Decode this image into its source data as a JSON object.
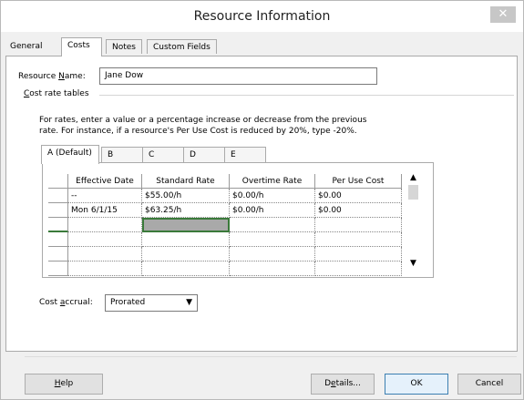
{
  "window": {
    "title": "Resource Information",
    "close_glyph": "✕"
  },
  "tabs": [
    {
      "label": "General"
    },
    {
      "label": "Costs"
    },
    {
      "label": "Notes"
    },
    {
      "label": "Custom Fields"
    }
  ],
  "resource_name": {
    "label_prefix": "Resource ",
    "label_underlined": "N",
    "label_suffix": "ame:",
    "value": "Jane Dow"
  },
  "cost_rate_tables": {
    "group_label_underlined": "C",
    "group_label_suffix": "ost rate tables",
    "instructions_line1": "For rates, enter a value or a percentage increase or decrease from the previous",
    "instructions_line2": "rate. For instance, if a resource's Per Use Cost is reduced by 20%, type -20%.",
    "subtabs": [
      "A (Default)",
      "B",
      "C",
      "D",
      "E"
    ],
    "columns": [
      "Effective Date",
      "Standard Rate",
      "Overtime Rate",
      "Per Use Cost"
    ],
    "rows": [
      [
        "--",
        "$55.00/h",
        "$0.00/h",
        "$0.00"
      ],
      [
        "Mon 6/1/15",
        "$63.25/h",
        "$0.00/h",
        "$0.00"
      ],
      [
        "",
        "",
        "",
        ""
      ],
      [
        "",
        "",
        "",
        ""
      ],
      [
        "",
        "",
        "",
        ""
      ],
      [
        "",
        "",
        "",
        ""
      ]
    ]
  },
  "cost_accrual": {
    "label_prefix": "Cost ",
    "label_underlined": "a",
    "label_suffix": "ccrual:",
    "value": "Prorated"
  },
  "buttons": {
    "help_underlined": "H",
    "help_rest": "elp",
    "details_prefix": "D",
    "details_underlined": "e",
    "details_rest": "tails...",
    "ok": "OK",
    "cancel": "Cancel"
  }
}
